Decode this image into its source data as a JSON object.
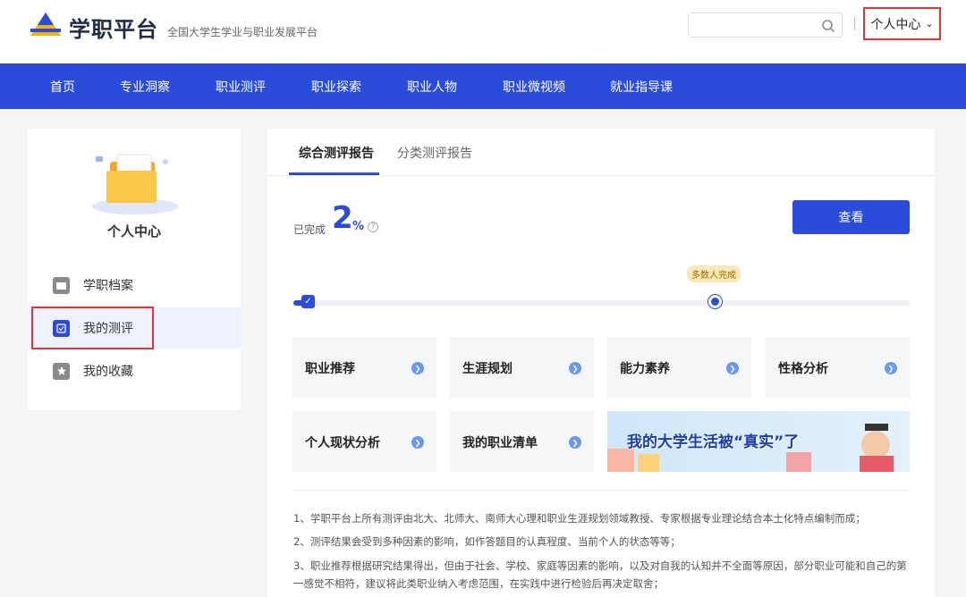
{
  "header": {
    "brand": "学职平台",
    "slogan": "全国大学生学业与职业发展平台",
    "search_placeholder": "",
    "user_center": "个人中心"
  },
  "nav": [
    "首页",
    "专业洞察",
    "职业测评",
    "职业探索",
    "职业人物",
    "职业微视频",
    "就业指导课"
  ],
  "sidebar": {
    "title": "个人中心",
    "items": [
      {
        "label": "学职档案",
        "icon": "folder-icon"
      },
      {
        "label": "我的测评",
        "icon": "checkbox-icon"
      },
      {
        "label": "我的收藏",
        "icon": "star-icon"
      }
    ]
  },
  "main": {
    "tabs": [
      "综合测评报告",
      "分类测评报告"
    ],
    "progress": {
      "label": "已完成",
      "value": "2",
      "unit": "%",
      "marker_label": "多数人完成"
    },
    "view_button": "查看",
    "cards": [
      "职业推荐",
      "生涯规划",
      "能力素养",
      "性格分析",
      "个人现状分析",
      "我的职业清单"
    ],
    "banner_text": "我的大学生活被“真实”了",
    "notes": [
      "1、学职平台上所有测评由北大、北师大、南师大心理和职业生涯规划领域教授、专家根据专业理论结合本土化特点编制而成；",
      "2、测评结果会受到多种因素的影响，如作答题目的认真程度、当前个人的状态等等；",
      "3、职业推荐根据研究结果得出，但由于社会、学校、家庭等因素的影响，以及对自我的认知并不全面等原因，部分职业可能和自己的第一感觉不相符，建议将此类职业纳入考虑范围，在实践中进行检验后再决定取舍；"
    ]
  },
  "colors": {
    "primary": "#2b4cdb",
    "highlight": "#e5333a"
  }
}
